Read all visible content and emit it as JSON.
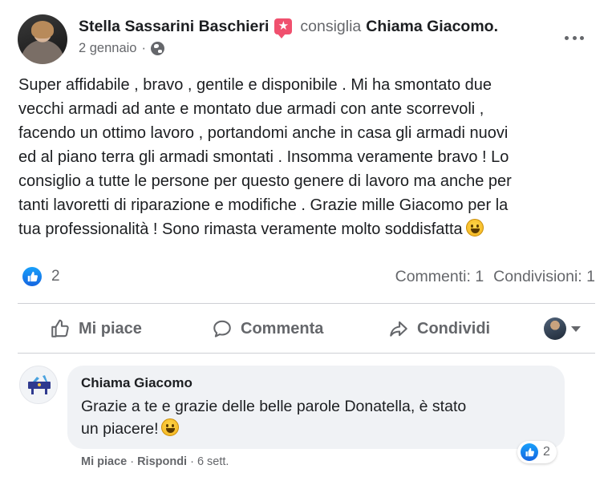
{
  "post": {
    "author": "Stella Sassarini Baschieri",
    "verb": "consiglia",
    "page_name": "Chiama Giacomo.",
    "date": "2 gennaio",
    "separator": "·",
    "text": "Super affidabile , bravo , gentile e disponibile . Mi ha smontato due\nvecchi armadi ad ante e montato due armadi con ante scorrevoli ,\nfacendo un ottimo lavoro , portandomi anche in casa gli armadi nuovi\ned al piano terra gli armadi smontati . Insomma veramente bravo ! Lo\nconsiglio a tutte le persone per questo genere di lavoro ma anche per\ntanti lavoretti di riparazione e modifiche . Grazie mille Giacomo per la\ntua professionalità ! Sono rimasta veramente molto soddisfatta"
  },
  "stats": {
    "reactions_count": "2",
    "comments": "Commenti: 1",
    "shares": "Condivisioni: 1"
  },
  "actions": {
    "like": "Mi piace",
    "comment": "Commenta",
    "share": "Condividi"
  },
  "comment": {
    "author": "Chiama Giacomo",
    "text": "Grazie a te e grazie delle belle parole Donatella, è stato\nun piacere!",
    "reactions_count": "2",
    "like": "Mi piace",
    "reply": "Rispondi",
    "dot": "·",
    "time": "6 sett."
  },
  "colors": {
    "accent": "#1877f2",
    "badge": "#f0506e",
    "secondary_text": "#65676b",
    "comment_bg": "#f0f2f5"
  }
}
